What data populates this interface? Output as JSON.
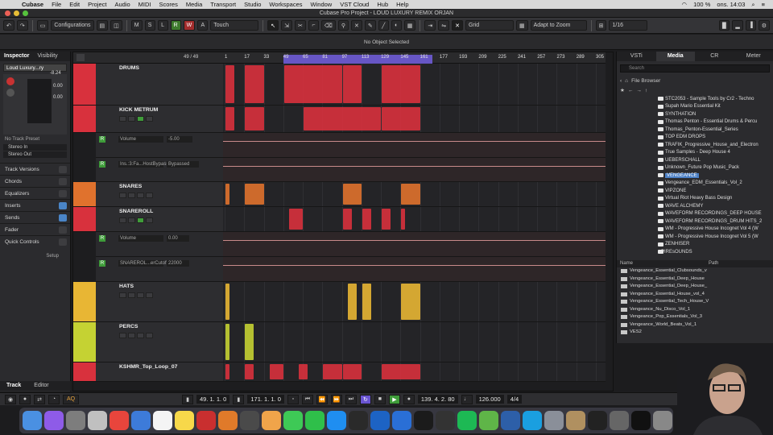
{
  "menubar": {
    "app": "Cubase",
    "items": [
      "File",
      "Edit",
      "Project",
      "Audio",
      "MIDI",
      "Scores",
      "Media",
      "Transport",
      "Studio",
      "Workspaces",
      "Window",
      "VST Cloud",
      "Hub",
      "Help"
    ],
    "battery": "100 %",
    "clock": "ons. 14:03"
  },
  "titlebar": {
    "title": "Cubase Pro Project - LOUD LUXURY REMIX ORJAN"
  },
  "toolbar": {
    "configurations": "Configurations",
    "mode_buttons": [
      "M",
      "S",
      "L",
      "R",
      "W",
      "A"
    ],
    "touch": "Touch",
    "grid": "Grid",
    "adapt": "Adapt to Zoom",
    "quantize": "1/16"
  },
  "infoline": {
    "text": "No Object Selected"
  },
  "inspector": {
    "tabs": [
      "Inspector",
      "Visibility"
    ],
    "track_name": "Loud Luxury...ry",
    "volume": "-8.24",
    "pan": "0.00",
    "readout": "0.00",
    "preset": "No Track Preset",
    "input": "Stereo In",
    "output": "Stereo Out",
    "sections": [
      "Track Versions",
      "Chords",
      "Equalizers",
      "Inserts",
      "Sends",
      "Fader",
      "Quick Controls"
    ],
    "setup": "Setup",
    "bottom_tabs": [
      "Track",
      "Editor"
    ]
  },
  "tracklist": {
    "count": "49 / 49",
    "tracks": [
      {
        "name": "DRUMS",
        "color": "#d8313d"
      },
      {
        "name": "KICK METRUM",
        "color": "#d8313d"
      },
      {
        "name": "SNARES",
        "color": "#e0722d"
      },
      {
        "name": "SNAREROLL",
        "color": "#d8313d"
      },
      {
        "name": "HATS",
        "color": "#e8b634"
      },
      {
        "name": "PERCS",
        "color": "#c5d233"
      },
      {
        "name": "KSHMR_Top_Loop_07",
        "color": "#d8313d"
      }
    ],
    "automation": [
      {
        "param": "Volume",
        "value": "-5.00"
      },
      {
        "param": "Ins.:3:Fa...HostBypass",
        "value": "Bypassed"
      },
      {
        "param": "Volume",
        "value": "0.00"
      },
      {
        "param": "SNAREROL...erCutoff",
        "value": "22000"
      }
    ]
  },
  "ruler": {
    "bars": [
      "1",
      "17",
      "33",
      "49",
      "65",
      "81",
      "97",
      "113",
      "129",
      "145",
      "161",
      "177",
      "193",
      "209",
      "225",
      "241",
      "257",
      "273",
      "289",
      "305"
    ]
  },
  "rightzone": {
    "tabs": [
      "VSTi",
      "Media",
      "CR",
      "Meter"
    ],
    "search_placeholder": "Search",
    "breadcrumb": "File Browser",
    "folders": [
      "STC2053 - Sample Tools by Cr2 - Techno",
      "Supah Mario Essential Kit",
      "SYNTHATION",
      "Thomas Penton - Essential Drums & Percu",
      "Thomas_Penton-Essential_Series",
      "TOP EDM DROPS",
      "TRAFIK_Progressive_House_and_Electron",
      "True Samples - Deep House 4",
      "UEBERSCHALL",
      "Unknown_Future Pop Music_Pack",
      "VENGEANCE",
      "Vengeance_EDM_Essentials_Vol_2",
      "VIPZONE",
      "Virtual Riot Heavy Bass Design",
      "WAVE ALCHEMY",
      "WAVEFORM RECORDINGS_DEEP HOUSE",
      "WAVEFORM RECORDINGS_DRUM HITS_2",
      "WM - Progressive House Incognet Vol 4 (W",
      "WM - Progressive House Incognet Vol 5 (W",
      "ZENHISER"
    ],
    "selected_folder": "VENGEANCE",
    "parent_folder": "sPIREsOUNDS",
    "list_headers": [
      "Name",
      "Path"
    ],
    "list_items": [
      "Vengeance_Essential_Clubsounds_v",
      "Vengeance_Essential_Deep_House",
      "Vengeance_Essential_Deep_House_",
      "Vengeance_Essential_House_vol_4",
      "Vengeance_Essential_Tech_House_V",
      "Vengeance_Nu_Disco_Vol_1",
      "Vengeance_Pop_Essentials_Vol_3",
      "Vengeance_World_Beats_Vol_1",
      "VES2"
    ]
  },
  "transport": {
    "left_locator": "49. 1. 1. 0",
    "right_locator": "171. 1. 1. 0",
    "position": "139. 4. 2. 80",
    "tempo": "126.000",
    "signature": "4/4",
    "aq": "AQ"
  },
  "colors": {
    "cycle": "#6e5bd6",
    "drums": "#d8313d",
    "snares": "#e0722d",
    "hats": "#e8b634",
    "percs": "#c5d233"
  },
  "dock_icons": [
    "finder-icon",
    "siri-icon",
    "system-preferences-icon",
    "launchpad-icon",
    "chrome-icon",
    "preview-icon",
    "calendar-icon",
    "notes-icon",
    "cubase-icon",
    "t-racks-icon",
    "ableton-icon",
    "photos-icon",
    "messages-icon",
    "facetime-icon",
    "app-store-icon",
    "terminal-icon",
    "waves-icon",
    "tools-icon",
    "splice-icon",
    "ilok-icon",
    "spotify-icon",
    "live-icon",
    "news-icon",
    "skype-icon",
    "plugin-icon",
    "archive-icon",
    "console-icon",
    "finder-window-icon",
    "piano-icon",
    "trash-icon"
  ]
}
